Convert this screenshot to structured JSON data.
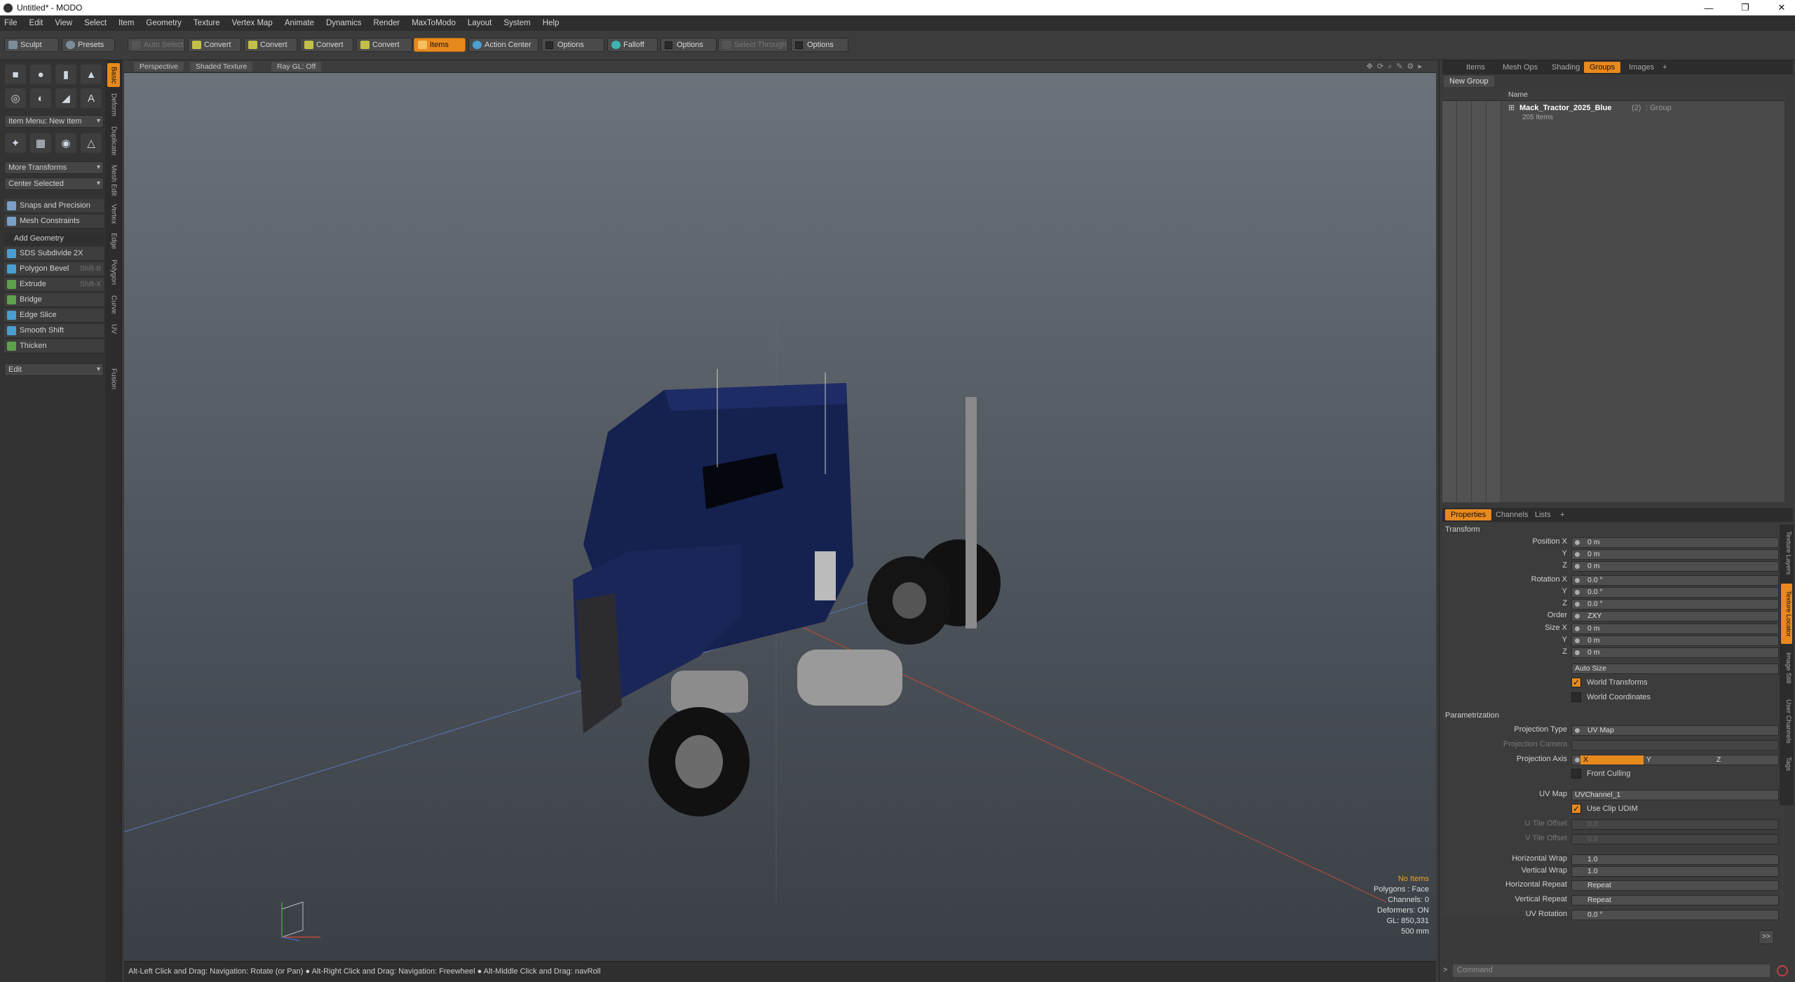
{
  "window": {
    "title": "Untitled* - MODO",
    "min": "—",
    "max": "❐",
    "close": "✕"
  },
  "menu": [
    "File",
    "Edit",
    "View",
    "Select",
    "Item",
    "Geometry",
    "Texture",
    "Vertex Map",
    "Animate",
    "Dynamics",
    "Render",
    "MaxToModo",
    "Layout",
    "System",
    "Help"
  ],
  "toolbar": {
    "sculpt": "Sculpt",
    "presets": "Presets",
    "auto_select": "Auto Select",
    "convert": "Convert",
    "items": "Items",
    "action_center": "Action Center",
    "options": "Options",
    "falloff": "Falloff",
    "select_through": "Select Through"
  },
  "left": {
    "vtabs": [
      "Basic",
      "Deform",
      "Duplicate",
      "Mesh Edit",
      "Vertex",
      "Edge",
      "Polygon",
      "Curve",
      "UV",
      "Fusion"
    ],
    "item_menu": "Item Menu: New Item",
    "more_transforms": "More Transforms",
    "center_selected": "Center Selected",
    "snaps": "Snaps and Precision",
    "mesh_constraints": "Mesh Constraints",
    "add_geometry": "Add Geometry",
    "tools": [
      {
        "label": "SDS Subdivide 2X",
        "shortcut": ""
      },
      {
        "label": "Polygon Bevel",
        "shortcut": "Shift-B"
      },
      {
        "label": "Extrude",
        "shortcut": "Shift-X"
      },
      {
        "label": "Bridge",
        "shortcut": ""
      },
      {
        "label": "Edge Slice",
        "shortcut": ""
      },
      {
        "label": "Smooth Shift",
        "shortcut": ""
      },
      {
        "label": "Thicken",
        "shortcut": ""
      }
    ],
    "edit": "Edit"
  },
  "viewport": {
    "perspective": "Perspective",
    "shaded": "Shaded Texture",
    "raygl": "Ray GL: Off",
    "info": {
      "items": "No Items",
      "polygons": "Polygons : Face",
      "channels": "Channels: 0",
      "deformers": "Deformers: ON",
      "gl": "GL: 850,331",
      "scale": "500 mm"
    }
  },
  "status": "Alt-Left Click and Drag: Navigation: Rotate (or Pan) ● Alt-Right Click and Drag: Navigation: Freewheel ● Alt-Middle Click and Drag: navRoll",
  "right": {
    "tabs": [
      "Items",
      "Mesh Ops",
      "Shading",
      "Groups",
      "Images"
    ],
    "new_group": "New Group",
    "name_col": "Name",
    "group": {
      "name": "Mack_Tractor_2025_Blue",
      "count": "(2)",
      "type": ": Group",
      "items": "205 Items"
    },
    "ptabs": [
      "Properties",
      "Channels",
      "Lists"
    ],
    "side_tabs": [
      "Texture Layers",
      "Texture Locator",
      "Image Still",
      "User Channels",
      "Tags"
    ],
    "transform": "Transform",
    "px": "Position X",
    "y": "Y",
    "z": "Z",
    "rx": "Rotation X",
    "order": "Order",
    "sx": "Size X",
    "v_m": "0 m",
    "v_deg": "0.0 °",
    "v_order": "ZXY",
    "auto_size": "Auto Size",
    "world_transforms": "World Transforms",
    "world_coords": "World Coordinates",
    "param": "Parametrization",
    "proj_type": "Projection Type",
    "proj_type_v": "UV Map",
    "proj_cam": "Projection Camera",
    "proj_axis": "Projection Axis",
    "ax": "X",
    "ay": "Y",
    "az": "Z",
    "front_culling": "Front Culling",
    "uvmap": "UV Map",
    "uvmap_v": "UVChannel_1",
    "use_clip": "Use Clip UDIM",
    "utile": "U Tile Offset",
    "vtile": "V Tile Offset",
    "tile_v": "0.0",
    "hwrap": "Horizontal Wrap",
    "vwrap": "Vertical Wrap",
    "wrap_v": "1.0",
    "hrep": "Horizontal Repeat",
    "vrep": "Vertical Repeat",
    "rep_v": "Repeat",
    "uvrot": "UV Rotation",
    "uvrot_v": "0.0 °",
    "more": ">>"
  },
  "command": {
    "prompt": ">",
    "placeholder": "Command"
  },
  "colors": {
    "accent": "#e8891d",
    "truck": "#15214f"
  }
}
